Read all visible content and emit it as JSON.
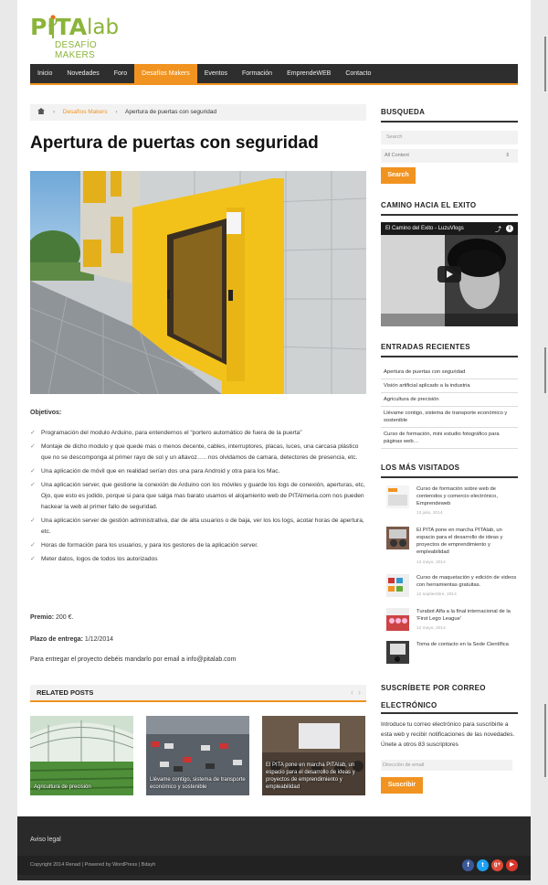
{
  "logo": {
    "name_main": "PITA",
    "name_suffix": "lab",
    "tagline": "DESAFÍO MAKERS"
  },
  "nav": [
    {
      "label": "Inicio"
    },
    {
      "label": "Novedades"
    },
    {
      "label": "Foro"
    },
    {
      "label": "Desafíos Makers",
      "active": true
    },
    {
      "label": "Eventos"
    },
    {
      "label": "Formación"
    },
    {
      "label": "EmprendeWEB"
    },
    {
      "label": "Contacto"
    }
  ],
  "breadcrumb": {
    "home_icon": "home-icon",
    "section": "Desafíos Makers",
    "current": "Apertura de puertas con seguridad"
  },
  "post": {
    "title": "Apertura de puertas con seguridad",
    "objectives_heading": "Objetivos:",
    "objectives": [
      "Programación del modulo Arduino, para entendernos el “portero automático de fuera de la puerta”",
      "Montaje de dicho modulo y que quede mas o menos decente, cables, interruptores, placas, luces, una carcasa plástico que no se descomponga al primer rayo de sol y un altavoz….. nos olvidamos de camara, detectores de presencia, etc.",
      "Una aplicación de móvil que en realidad serían dos una para Android y otra para los Mac.",
      "Una aplicación server, que gestione la conexión de Arduino con los móviles y guarde los logs de conexión, aperturas, etc, Ojo, que esto es jodido, porque si para que salga mas barato usamos el alojamiento web de PITAlmeria.com nos pueden hackear la web al primer fallo de seguridad.",
      "Una aplicación server de gestión administrativa, dar de alta usuarios o de baja, ver los los logs, acotar horas de apertura, etc.",
      "Horas de formación para los usuarios, y para los gestores de la aplicación server.",
      "Meter datos, logos de todos los autorizados"
    ],
    "prize_label": "Premio:",
    "prize_value": "200 €.",
    "deadline_label": "Plazo de entrega:",
    "deadline_value": "1/12/2014",
    "delivery_note": "Para entregar el proyecto debéis mandarlo por email a info@pitalab.com"
  },
  "related": {
    "heading": "RELATED POSTS",
    "items": [
      {
        "caption": "Agricultura de precisión"
      },
      {
        "caption": "Llévame contigo, sistema de transporte económico y sostenible"
      },
      {
        "caption": "El PITA pone en marcha PITAlab, un espacio para el desarrollo de ideas y proyectos de emprendimiento y empleabilidad"
      }
    ]
  },
  "sidebar": {
    "search": {
      "title": "BUSQUEDA",
      "placeholder": "Search",
      "select_value": "All Content",
      "button": "Search"
    },
    "video": {
      "title": "CAMINO HACIA EL EXITO",
      "video_title": "El Camino del Exito - LuzuVlogs"
    },
    "recent": {
      "title": "ENTRADAS RECIENTES",
      "items": [
        "Apertura de puertas con seguridad",
        "Visión artificial aplicado a la industria",
        "Agricultura de precisión",
        "Llévame contigo, sistema de transporte económico y sostenible",
        "Curso de formación, mini estudio fotográfico para páginas web…"
      ]
    },
    "visited": {
      "title": "LOS MÁS VISITADOS",
      "items": [
        {
          "text": "Curso de formación sobre web de contenidos y comercio electrónico, Emprendeweb",
          "date": "13 julio, 2014"
        },
        {
          "text": "El PITA pone en marcha PITAlab, un espacio para el desarrollo de ideas y proyectos de emprendimiento y empleabilidad",
          "date": "13 mayo, 2014"
        },
        {
          "text": "Curso de maquetación y edición de videos con herramientas gratuitas.",
          "date": "12 septiembre, 2014"
        },
        {
          "text": "Turabot Alfa a la final internacional de la 'First Lego League'",
          "date": "12 mayo, 2014"
        },
        {
          "text": "Toma de contacto en la Sede Científica",
          "date": "12 mayo, 2014"
        }
      ]
    },
    "subscribe": {
      "title_line1": "SUSCRÍBETE POR CORREO",
      "title_line2": "ELECTRÓNICO",
      "text": "Introduce tu correo electrónico para suscribirte a esta web y recibir notificaciones de las novedades.",
      "count": "Únete a otros 83 suscriptores",
      "email_placeholder": "Dirección de email",
      "button": "Suscribir"
    }
  },
  "footer": {
    "legal": "Aviso legal",
    "copyright": "Copyright 2014 Renad | Powered by WordPress | Bdayh",
    "social": [
      {
        "icon": "facebook-icon",
        "glyph": "f",
        "color": "#3b5998"
      },
      {
        "icon": "twitter-icon",
        "glyph": "t",
        "color": "#1da1f2"
      },
      {
        "icon": "google-plus-icon",
        "glyph": "g+",
        "color": "#dd4b39"
      },
      {
        "icon": "youtube-icon",
        "glyph": "▶",
        "color": "#d9362b"
      }
    ]
  },
  "colors": {
    "accent": "#f19320",
    "brand_green": "#8bb43a",
    "nav_bg": "#2e2e2e"
  }
}
